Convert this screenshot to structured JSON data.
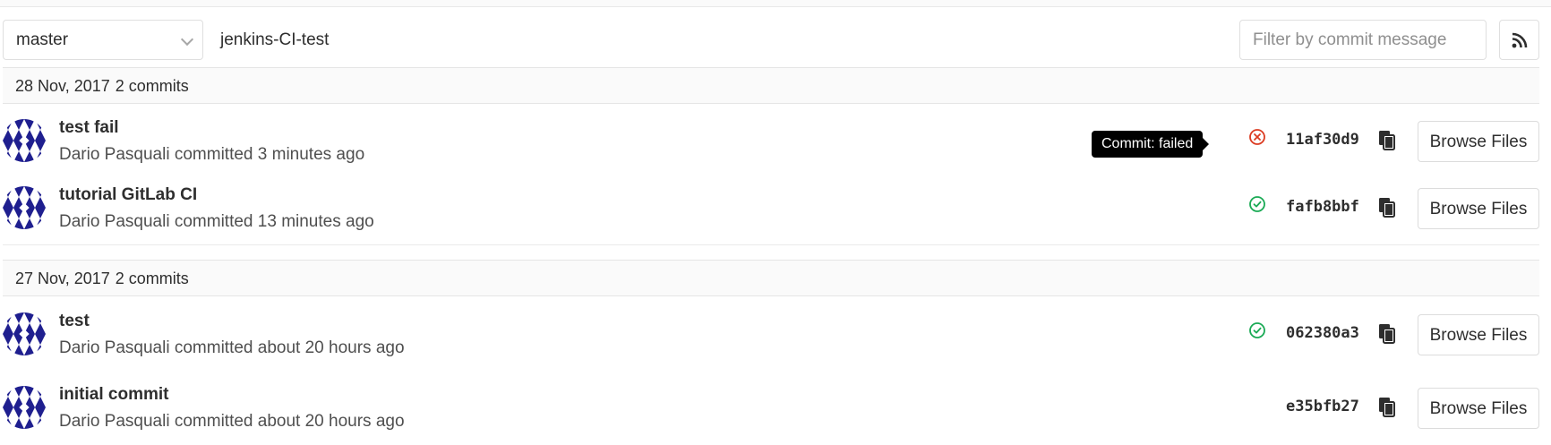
{
  "toolbar": {
    "branch": "master",
    "path": "jenkins-CI-test",
    "filter_placeholder": "Filter by commit message",
    "rss_icon": "rss-icon"
  },
  "days": [
    {
      "date": "28 Nov, 2017",
      "count": "2 commits",
      "commits": [
        {
          "title": "test fail",
          "author": "Dario Pasquali",
          "verb": "committed",
          "time": "3 minutes ago",
          "status": "failed",
          "sha": "11af30d9",
          "browse_label": "Browse Files"
        },
        {
          "title": "tutorial GitLab CI",
          "author": "Dario Pasquali",
          "verb": "committed",
          "time": "13 minutes ago",
          "status": "success",
          "sha": "fafb8bbf",
          "browse_label": "Browse Files"
        }
      ]
    },
    {
      "date": "27 Nov, 2017",
      "count": "2 commits",
      "commits": [
        {
          "title": "test",
          "author": "Dario Pasquali",
          "verb": "committed",
          "time": "about 20 hours ago",
          "status": "success",
          "sha": "062380a3",
          "browse_label": "Browse Files"
        },
        {
          "title": "initial commit",
          "author": "Dario Pasquali",
          "verb": "committed",
          "time": "about 20 hours ago",
          "status": "none",
          "sha": "e35bfb27",
          "browse_label": "Browse Files"
        }
      ]
    }
  ],
  "tooltip": {
    "text": "Commit: failed"
  },
  "colors": {
    "failed": "#db3b21",
    "success": "#1aaa55",
    "avatar_fill": "#1f1f8f"
  }
}
